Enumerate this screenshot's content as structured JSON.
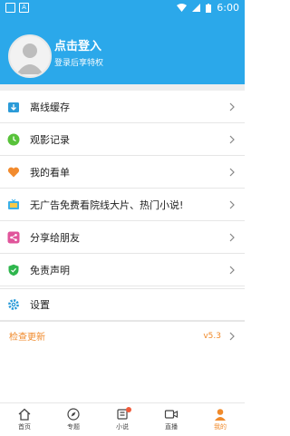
{
  "status": {
    "time": "6:00"
  },
  "header": {
    "title": "点击登入",
    "subtitle": "登录后享特权"
  },
  "menu": [
    {
      "label": "离线缓存"
    },
    {
      "label": "观影记录"
    },
    {
      "label": "我的看单"
    },
    {
      "label": "无广告免费看院线大片、热门小说!"
    },
    {
      "label": "分享给朋友"
    },
    {
      "label": "免责声明"
    },
    {
      "label": "设置"
    }
  ],
  "update": {
    "label": "检查更新",
    "version": "v5.3"
  },
  "tabs": [
    {
      "label": "首页"
    },
    {
      "label": "专题"
    },
    {
      "label": "小说"
    },
    {
      "label": "直播"
    },
    {
      "label": "我的"
    }
  ]
}
